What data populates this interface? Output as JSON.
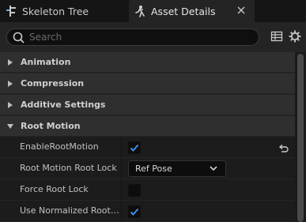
{
  "tabs": [
    {
      "label": "Skeleton Tree",
      "active": false,
      "icon": "skeleton-tree-icon"
    },
    {
      "label": "Asset Details",
      "active": true,
      "icon": "asset-details-icon"
    }
  ],
  "search": {
    "placeholder": "Search",
    "value": ""
  },
  "toolbar": {
    "icons": [
      "table-view-icon",
      "settings-gear-icon"
    ]
  },
  "categories": [
    {
      "label": "Animation",
      "expanded": false
    },
    {
      "label": "Compression",
      "expanded": false
    },
    {
      "label": "Additive Settings",
      "expanded": false
    },
    {
      "label": "Root Motion",
      "expanded": true
    }
  ],
  "properties": [
    {
      "name": "EnableRootMotion",
      "type": "checkbox",
      "checked": true,
      "reset_to_default": true
    },
    {
      "name": "Root Motion Root Lock",
      "type": "combo",
      "value": "Ref Pose"
    },
    {
      "name": "Force Root Lock",
      "type": "checkbox",
      "checked": false
    },
    {
      "name": "Use Normalized Root…",
      "type": "checkbox",
      "checked": true
    }
  ],
  "colors": {
    "accent": "#3d8ee8",
    "panel": "#242424",
    "category": "#2f2f2f",
    "row": "#1c1c1c"
  }
}
